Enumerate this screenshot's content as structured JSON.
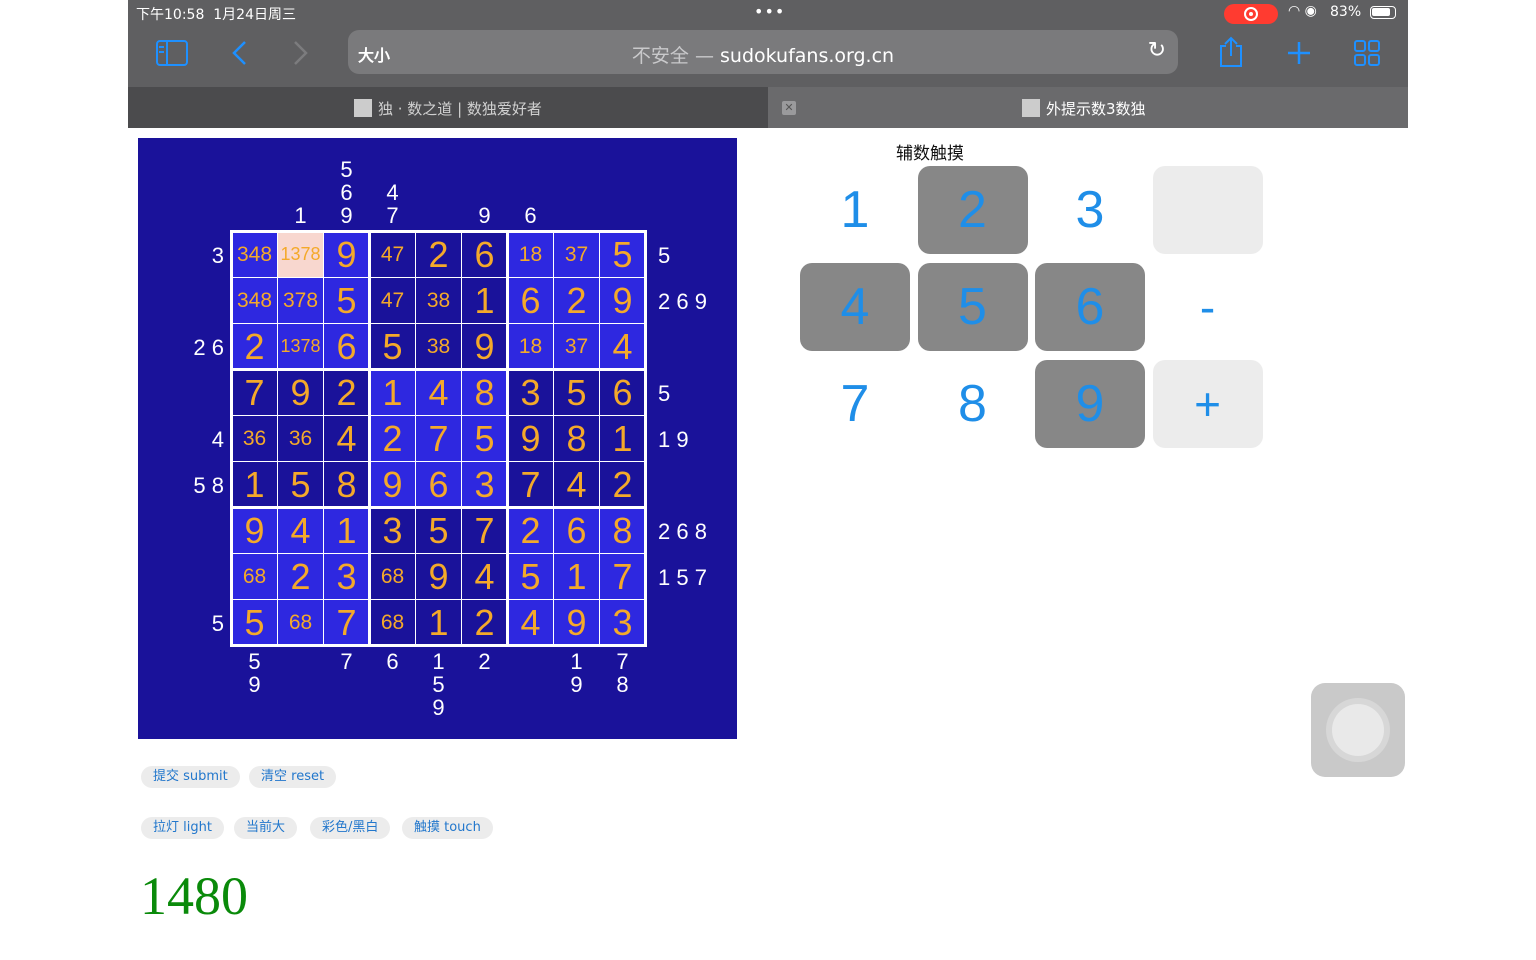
{
  "status": {
    "time": "下午10:58",
    "date": "1月24日周三",
    "battery": "83%"
  },
  "toolbar": {
    "size_label": "大小",
    "url_prefix": "不安全 — ",
    "url_host": "sudokufans.org.cn"
  },
  "tabs": [
    {
      "label": "独 · 数之道 | 数独爱好者"
    },
    {
      "label": "外提示数3数独"
    }
  ],
  "puzzle": {
    "grid": [
      [
        "348",
        "1378",
        "9",
        "47",
        "2",
        "6",
        "18",
        "37",
        "5"
      ],
      [
        "348",
        "378",
        "5",
        "47",
        "38",
        "1",
        "6",
        "2",
        "9"
      ],
      [
        "2",
        "1378",
        "6",
        "5",
        "38",
        "9",
        "18",
        "37",
        "4"
      ],
      [
        "7",
        "9",
        "2",
        "1",
        "4",
        "8",
        "3",
        "5",
        "6"
      ],
      [
        "36",
        "36",
        "4",
        "2",
        "7",
        "5",
        "9",
        "8",
        "1"
      ],
      [
        "1",
        "5",
        "8",
        "9",
        "6",
        "3",
        "7",
        "4",
        "2"
      ],
      [
        "9",
        "4",
        "1",
        "3",
        "5",
        "7",
        "2",
        "6",
        "8"
      ],
      [
        "68",
        "2",
        "3",
        "68",
        "9",
        "4",
        "5",
        "1",
        "7"
      ],
      [
        "5",
        "68",
        "7",
        "68",
        "1",
        "2",
        "4",
        "9",
        "3"
      ]
    ],
    "selected_cell": {
      "row": 0,
      "col": 1
    },
    "colors": {
      "board": "#1a129a",
      "box_light": "#2e28e0",
      "selected": "#f8d7cf",
      "digit": "#f4a92a",
      "clue": "#ffffff"
    },
    "clues_top": [
      [],
      [
        "1"
      ],
      [
        "5",
        "6",
        "9"
      ],
      [
        "4",
        "7"
      ],
      [],
      [
        "9"
      ],
      [
        "6"
      ],
      [],
      []
    ],
    "clues_bottom": [
      [
        "5",
        "9"
      ],
      [],
      [
        "7"
      ],
      [
        "6"
      ],
      [
        "1",
        "5",
        "9"
      ],
      [
        "2"
      ],
      [],
      [
        "1",
        "9"
      ],
      [
        "7",
        "8"
      ]
    ],
    "clues_left": [
      "3",
      "",
      "2 6",
      "",
      "4",
      "5 8",
      "",
      "",
      "5"
    ],
    "clues_right": [
      "5",
      "2 6 9",
      "",
      "5",
      "1 9",
      "",
      "2 6 8",
      "1 5 7",
      ""
    ]
  },
  "buttons": {
    "submit": "提交 submit",
    "reset": "清空 reset",
    "light": "拉灯 light",
    "current_size": "当前大",
    "color_mode": "彩色/黑白",
    "touch": "触摸 touch"
  },
  "score": "1480",
  "keypad": {
    "title": "辅数触摸",
    "keys": [
      {
        "label": "1",
        "style": "plain"
      },
      {
        "label": "2",
        "style": "dark"
      },
      {
        "label": "3",
        "style": "plain"
      },
      {
        "label": "",
        "style": "light"
      },
      {
        "label": "4",
        "style": "dark"
      },
      {
        "label": "5",
        "style": "dark"
      },
      {
        "label": "6",
        "style": "dark"
      },
      {
        "label": "-",
        "style": "plain"
      },
      {
        "label": "7",
        "style": "plain"
      },
      {
        "label": "8",
        "style": "plain"
      },
      {
        "label": "9",
        "style": "dark"
      },
      {
        "label": "+",
        "style": "light"
      }
    ]
  },
  "icons": [
    "sidebar-icon",
    "back-icon",
    "forward-icon",
    "reload-icon",
    "share-icon",
    "new-tab-icon",
    "tabs-overview-icon",
    "wifi-icon",
    "battery-icon",
    "record-icon",
    "assistive-touch-icon"
  ]
}
